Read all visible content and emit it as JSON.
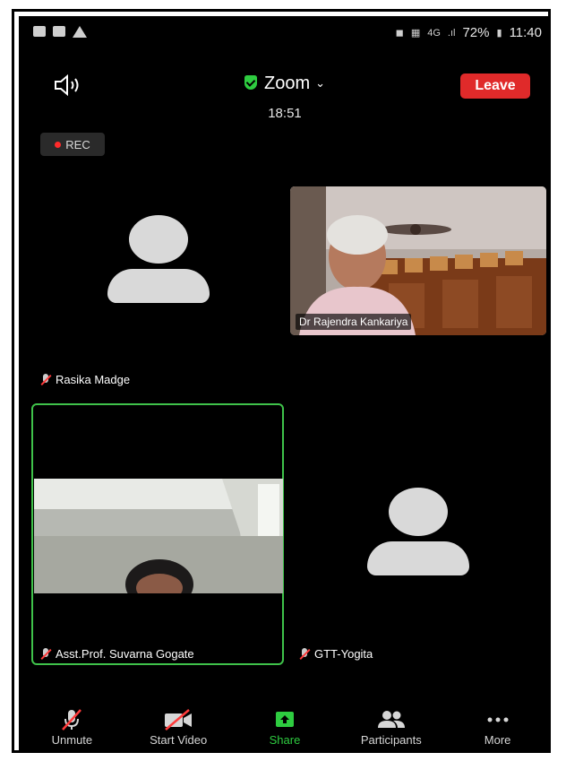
{
  "status_bar": {
    "battery": "72%",
    "time": "11:40",
    "network": "4G"
  },
  "header": {
    "app_name": "Zoom",
    "timer": "18:51",
    "leave_label": "Leave"
  },
  "recording": {
    "label": "REC"
  },
  "participants": [
    {
      "name": "Rasika Madge"
    },
    {
      "name": "Dr Rajendra Kankariya"
    },
    {
      "name": "Asst.Prof. Suvarna Gogate"
    },
    {
      "name": "GTT-Yogita"
    }
  ],
  "toolbar": {
    "unmute": "Unmute",
    "start_video": "Start Video",
    "share": "Share",
    "participants": "Participants",
    "more": "More"
  },
  "colors": {
    "accent_green": "#2ecc40",
    "leave_red": "#e02a2a"
  }
}
